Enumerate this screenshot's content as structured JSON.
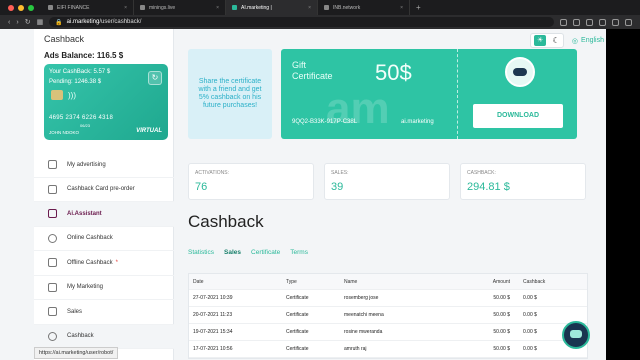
{
  "browser": {
    "tabs": [
      {
        "label": "EIFI FINANCE",
        "active": false
      },
      {
        "label": "minings.live",
        "active": false
      },
      {
        "label": "AI.marketing |",
        "active": true
      },
      {
        "label": "INB.network",
        "active": false
      }
    ],
    "new_tab": "+",
    "url_domain": "ai.marketing",
    "url_path": "/user/cashback/",
    "status_url": "https://ai.marketing/user/robot/"
  },
  "sidebar": {
    "title": "Cashback",
    "balance": "Ads Balance: 116.5 $",
    "card": {
      "cashback": "Your CashBack: 5.57 $",
      "pending": "Pending: 1246.38 $",
      "number": "4695 2374 6226 4318",
      "expiry": "06/23",
      "holder": "JOHN NDOKO",
      "type": "VIRTUAL",
      "refresh_icon": "refresh-icon"
    },
    "menu": [
      {
        "label": "My advertising",
        "icon": "megaphone-icon"
      },
      {
        "label": "Cashback Card pre-order",
        "icon": "card-icon"
      },
      {
        "label": "Ai.Assistant",
        "icon": "assistant-icon"
      },
      {
        "label": "Online Cashback",
        "icon": "globe-icon"
      },
      {
        "label": "Offline Cashback",
        "icon": "store-icon",
        "star": "*"
      },
      {
        "label": "My Marketing",
        "icon": "chart-icon"
      },
      {
        "label": "Sales",
        "icon": "cart-icon"
      },
      {
        "label": "Cashback",
        "icon": "dollar-icon"
      }
    ]
  },
  "header": {
    "language": "English"
  },
  "promo": {
    "text": "Share the certificate with a friend and get 5% cashback on his future purchases!"
  },
  "gift": {
    "title_line1": "Gift",
    "title_line2": "Certificate",
    "amount": "50$",
    "code": "9QQ2-B33K-917P-C38L",
    "brand": "ai.marketing",
    "watermark": "am",
    "download": "DOWNLOAD"
  },
  "stats": [
    {
      "label": "ACTIVATIONS:",
      "value": "76"
    },
    {
      "label": "SALES:",
      "value": "39"
    },
    {
      "label": "CASHBACK:",
      "value": "294.81 $"
    }
  ],
  "main": {
    "heading": "Cashback",
    "tabs": [
      "Statistics",
      "Sales",
      "Certificate",
      "Terms"
    ],
    "selected_tab": "Sales"
  },
  "table": {
    "headers": [
      "Date",
      "Type",
      "Name",
      "Amount",
      "Cashback"
    ],
    "rows": [
      [
        "27-07-2021 10:39",
        "Certificate",
        "rosemberg jose",
        "50.00 $",
        "0.00 $"
      ],
      [
        "20-07-2021 11:23",
        "Certificate",
        "meenatchi meena",
        "50.00 $",
        "0.00 $"
      ],
      [
        "19-07-2021 15:34",
        "Certificate",
        "rosine mweranda",
        "50.00 $",
        "0.00 $"
      ],
      [
        "17-07-2021 10:56",
        "Certificate",
        "amruth raj",
        "50.00 $",
        "0.00 $"
      ]
    ]
  },
  "colors": {
    "accent": "#2bb99a",
    "ai_item": "#6a1b4d"
  }
}
